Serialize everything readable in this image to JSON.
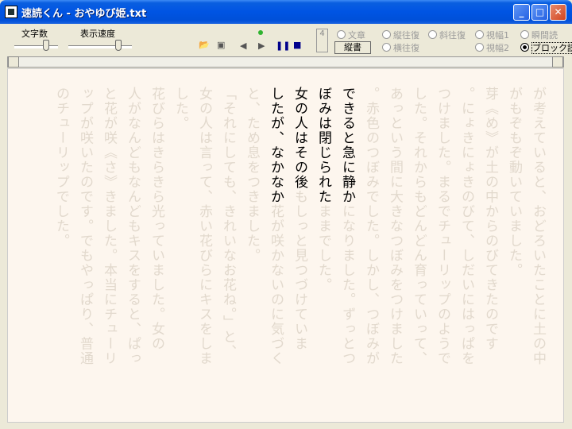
{
  "window": {
    "title": "速読くん - おやゆび姫.txt"
  },
  "toolbar": {
    "char_count_label": "文字数",
    "speed_label": "表示速度",
    "page_box": "4",
    "view_button": "縦書",
    "radios": [
      {
        "label": "文章",
        "state": "disabled"
      },
      {
        "label": "縦往復",
        "state": "disabled"
      },
      {
        "label": "斜往復",
        "state": "disabled"
      },
      {
        "label": "視幅1",
        "state": "disabled"
      },
      {
        "label": "瞬間読",
        "state": "disabled"
      },
      {
        "label": "横往復",
        "state": "disabled"
      },
      {
        "label": "視幅2",
        "state": "disabled"
      },
      {
        "label": "ブロック読",
        "state": "selected"
      }
    ]
  },
  "reader": {
    "columns": [
      {
        "text": "が考えていると、おどろいたことに土の中",
        "style": "faded"
      },
      {
        "text": "がもぞもぞ動いていました。",
        "style": "faded"
      },
      {
        "text": "芽《め》が土の中からのびてきたのです",
        "style": "faded"
      },
      {
        "text": "。にょきにょきのびて、しだいにはっぱを",
        "style": "faded"
      },
      {
        "text": "つけました。まるでチューリップのようで",
        "style": "faded"
      },
      {
        "text": "した。それからもどんどん育っていって、",
        "style": "faded"
      },
      {
        "text": "あっという間に大きなつぼみをつけました",
        "style": "faded"
      },
      {
        "text": "。赤色のつぼみでした。しかし、つぼみが",
        "style": "faded"
      },
      {
        "text": "できると急に静かになりました。ずっとつ",
        "style": "mixed",
        "split": 8
      },
      {
        "text": "ぼみは閉じられたままでした。",
        "style": "mixed",
        "split": 8
      },
      {
        "text": " 女の人はその後もしっと見つづけていま",
        "style": "mixed",
        "split": 8
      },
      {
        "text": "したが、なかなか花が咲かないのに気づく",
        "style": "mixed",
        "split": 8
      },
      {
        "text": "と、ため息をつきました。",
        "style": "faded"
      },
      {
        "text": "「それにしても、きれいなお花ね。」と、",
        "style": "faded"
      },
      {
        "text": "女の人は言って、赤い花びらにキスをしま",
        "style": "faded"
      },
      {
        "text": "した。",
        "style": "faded"
      },
      {
        "text": " 花びらはきらきら光っていました。女の",
        "style": "faded"
      },
      {
        "text": "人がなんどもなんどもキスをすると、ぱっ",
        "style": "faded"
      },
      {
        "text": "と花が咲《さ》きました。本当にチューリ",
        "style": "faded"
      },
      {
        "text": "ップが咲いたのです。でもやっぱり、普通",
        "style": "faded"
      },
      {
        "text": "のチューリップでした。",
        "style": "faded"
      }
    ]
  }
}
